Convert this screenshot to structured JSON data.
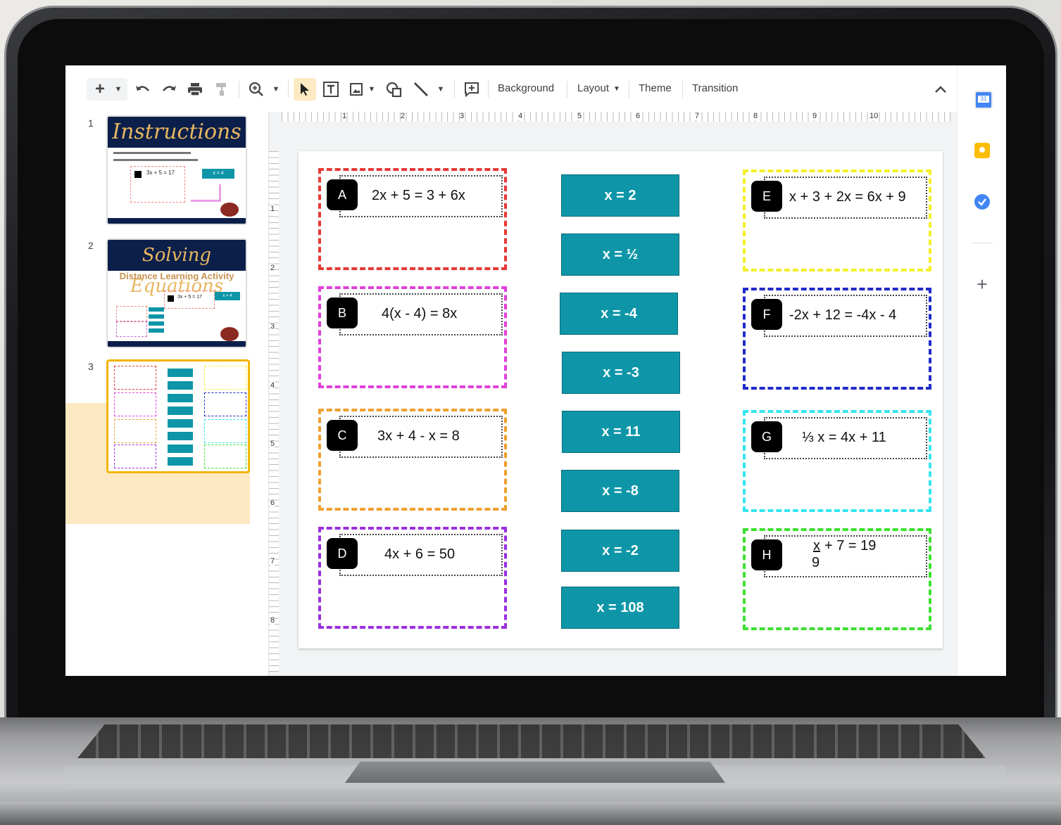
{
  "toolbar": {
    "add_icon": "+",
    "background_label": "Background",
    "layout_label": "Layout",
    "theme_label": "Theme",
    "transition_label": "Transition",
    "collapse_icon": "^"
  },
  "ruler": {
    "h_numbers": [
      "1",
      "2",
      "3",
      "4",
      "5",
      "6",
      "7",
      "8",
      "9",
      "10"
    ],
    "v_numbers": [
      "1",
      "2",
      "3",
      "4",
      "5",
      "6",
      "7",
      "8"
    ]
  },
  "slides": [
    {
      "number": "1",
      "title": "Instructions",
      "eq": "3x + 5 = 17",
      "ans": "x = 4"
    },
    {
      "number": "2",
      "title": "Solving Equations",
      "subtitle": "Distance Learning Activity",
      "eq": "3x + 5 = 17",
      "ans": "x = 4"
    },
    {
      "number": "3"
    }
  ],
  "problems": [
    {
      "letter": "A",
      "equation": "2x + 5 = 3 + 6x",
      "color": "#e53935"
    },
    {
      "letter": "B",
      "equation": "4(x - 4) = 8x",
      "color": "#e040d8"
    },
    {
      "letter": "C",
      "equation": "3x + 4 - x = 8",
      "color": "#f0a030"
    },
    {
      "letter": "D",
      "equation": "4x + 6 = 50",
      "color": "#9a30e0"
    },
    {
      "letter": "E",
      "equation": "x + 3 + 2x = 6x + 9",
      "color": "#f5ef2a"
    },
    {
      "letter": "F",
      "equation": "-2x + 12 = -4x - 4",
      "color": "#1f2bc9"
    },
    {
      "letter": "G",
      "equation": "⅓ x = 4x + 11",
      "color": "#35e5ee"
    },
    {
      "letter": "H",
      "equation_num": "x",
      "equation_den": "9",
      "equation_rest": "+ 7 = 19",
      "color": "#3de030"
    }
  ],
  "answers": [
    "x = 2",
    "x = ½",
    "x = -4",
    "x = -3",
    "x = 11",
    "x = -8",
    "x = -2",
    "x = 108"
  ],
  "rightbar": {
    "add_icon": "+"
  }
}
